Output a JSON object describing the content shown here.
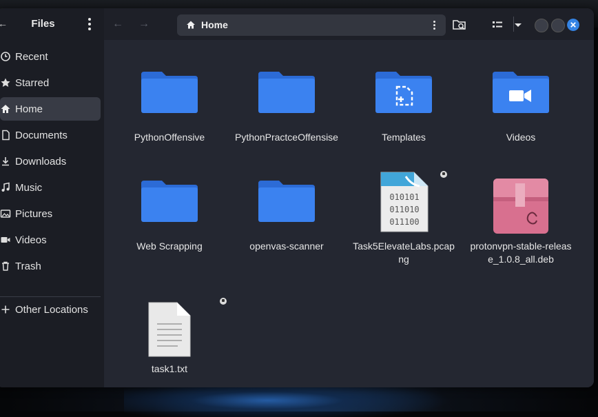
{
  "sidebar": {
    "title": "Files",
    "items": [
      {
        "label": "Recent",
        "icon": "clock-icon"
      },
      {
        "label": "Starred",
        "icon": "star-icon"
      },
      {
        "label": "Home",
        "icon": "home-icon",
        "active": true
      },
      {
        "label": "Documents",
        "icon": "document-icon"
      },
      {
        "label": "Downloads",
        "icon": "download-icon"
      },
      {
        "label": "Music",
        "icon": "music-icon"
      },
      {
        "label": "Pictures",
        "icon": "picture-icon"
      },
      {
        "label": "Videos",
        "icon": "video-icon"
      },
      {
        "label": "Trash",
        "icon": "trash-icon"
      }
    ],
    "other_locations": "Other Locations"
  },
  "header": {
    "path": "Home"
  },
  "files": [
    {
      "name": "PythonOffensive",
      "type": "folder"
    },
    {
      "name": "PythonPractceOffensise",
      "type": "folder"
    },
    {
      "name": "Templates",
      "type": "folder-templates"
    },
    {
      "name": "Videos",
      "type": "folder-videos"
    },
    {
      "name": "Web Scrapping",
      "type": "folder"
    },
    {
      "name": "openvas-scanner",
      "type": "folder"
    },
    {
      "name": "Task5ElevateLabs.pcapng",
      "type": "pcap",
      "locked": true
    },
    {
      "name": "protonvpn-stable-release_1.0.8_all.deb",
      "type": "deb"
    },
    {
      "name": "task1.txt",
      "type": "text",
      "locked": true
    }
  ],
  "colors": {
    "folder": "#3b82f0",
    "folder_tab": "#2c6bd6",
    "close_button": "#3584e4",
    "deb": "#d8708f"
  }
}
